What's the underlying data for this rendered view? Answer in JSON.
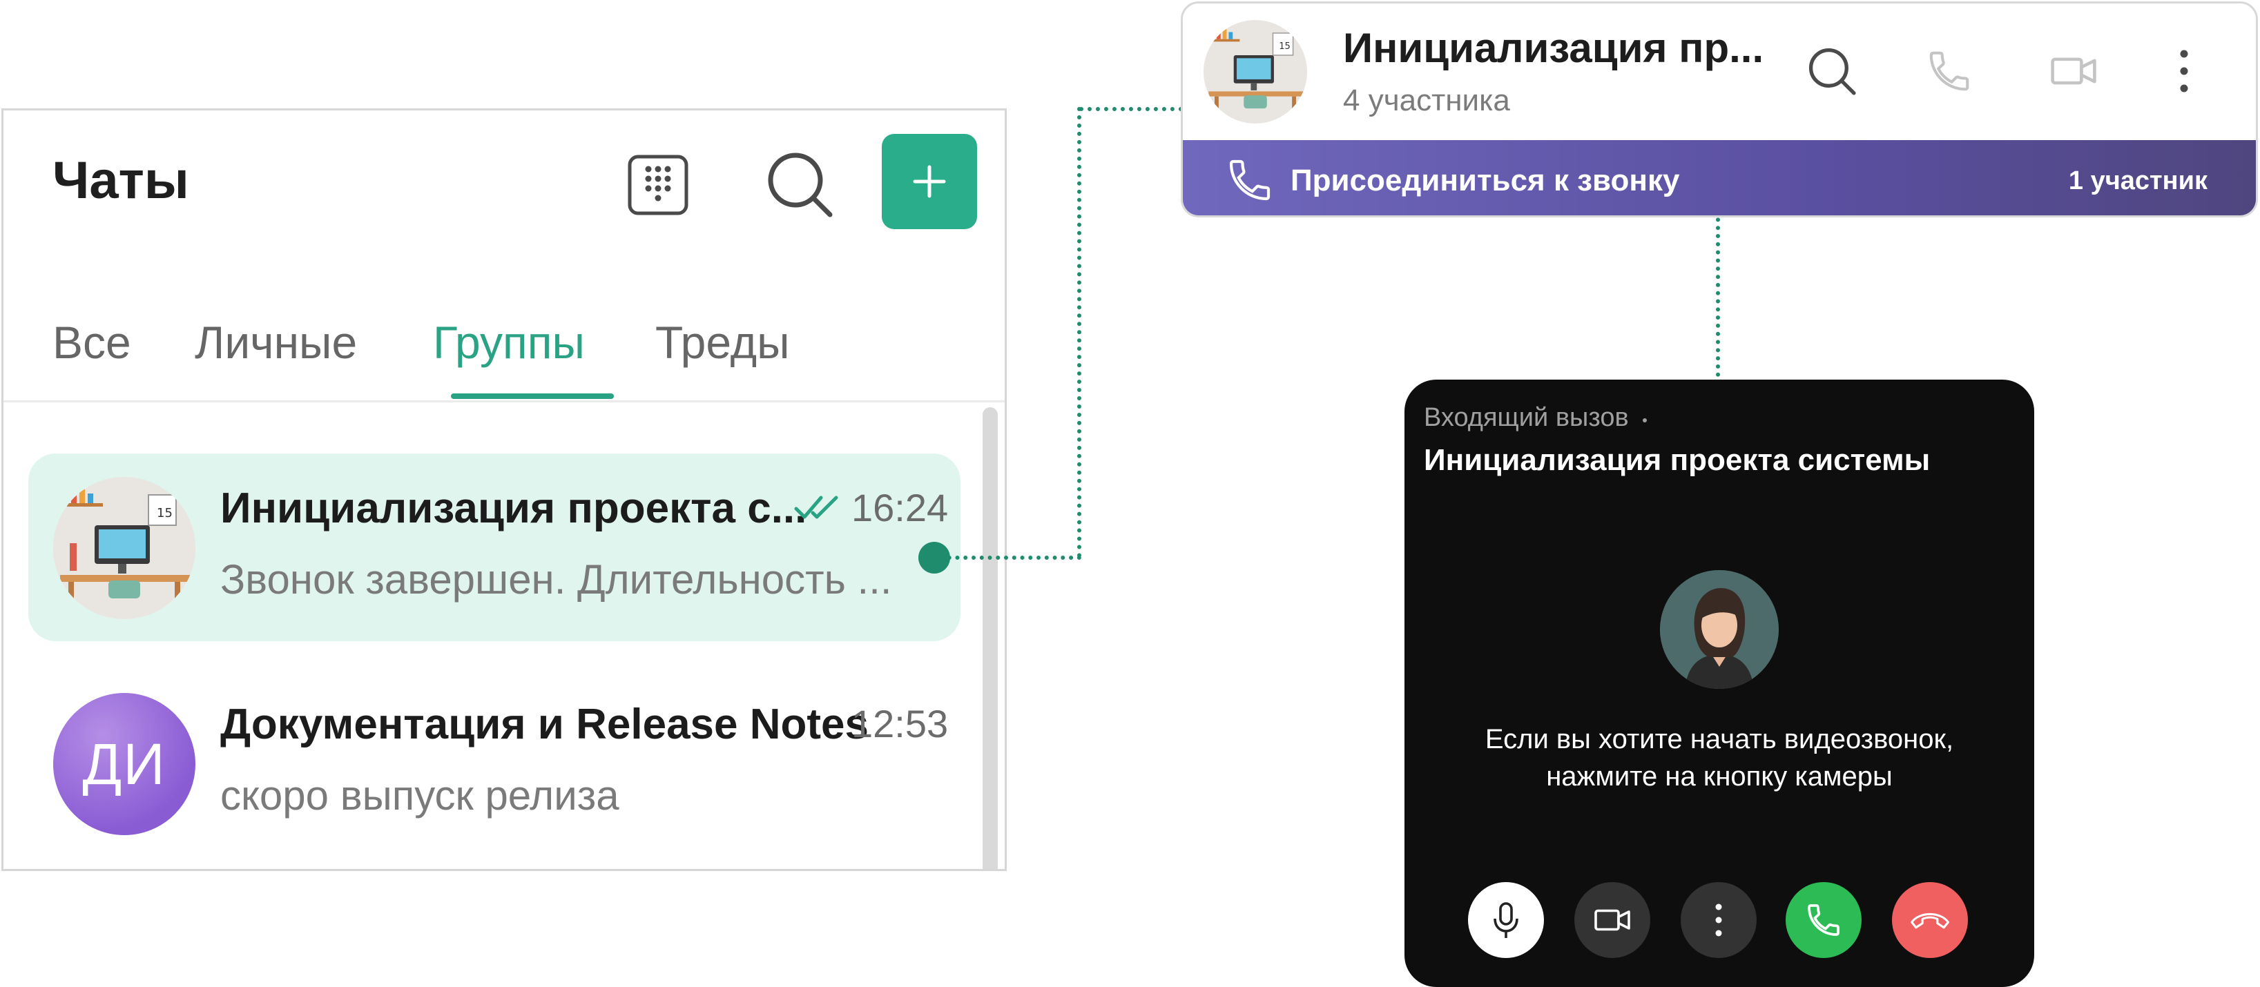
{
  "chats_panel": {
    "title": "Чаты",
    "tabs": [
      {
        "label": "Все",
        "active": false
      },
      {
        "label": "Личные",
        "active": false
      },
      {
        "label": "Группы",
        "active": true
      },
      {
        "label": "Треды",
        "active": false
      }
    ],
    "items": [
      {
        "title": "Инициализация проекта с...",
        "time": "16:24",
        "preview": "Звонок завершен. Длительность ...",
        "read_icon": "double-check-icon",
        "selected": true
      },
      {
        "title": "Документация и Release Notes",
        "time": "12:53",
        "preview": "скоро выпуск релиза",
        "avatar_initials": "ДИ",
        "selected": false
      }
    ]
  },
  "chat_header": {
    "title": "Инициализация пр...",
    "members": "4 участника",
    "join_call_label": "Присоединиться к звонку",
    "call_participants": "1 участник"
  },
  "incoming_call": {
    "status": "Входящий вызов",
    "title": "Инициализация проекта системы",
    "hint_line1": "Если вы хотите начать видеозвонок,",
    "hint_line2": "нажмите на кнопку камеры"
  },
  "colors": {
    "accent_green": "#2aad8a",
    "connector": "#1f8c6e",
    "selected_row": "#dff5ee",
    "join_bar_start": "#7068bd",
    "join_bar_end": "#4f467f",
    "accept": "#2dbb55",
    "decline": "#f06060",
    "call_bg": "#0e0e0e"
  }
}
